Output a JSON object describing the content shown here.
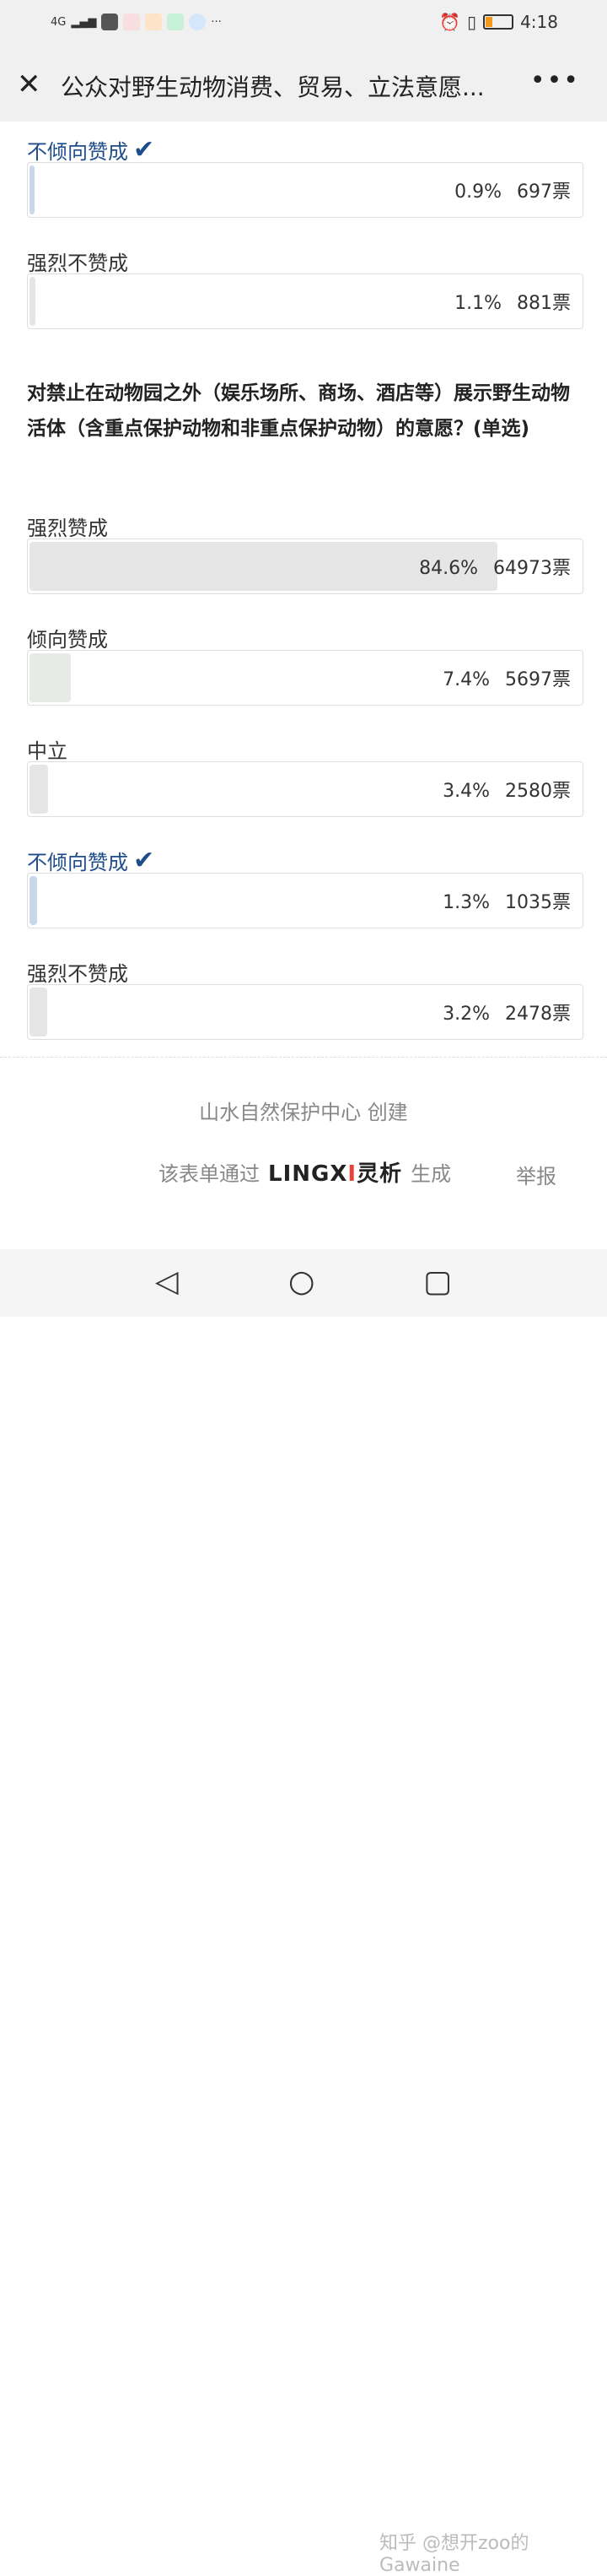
{
  "status_bar": {
    "network": "4G",
    "time": "4:18",
    "battery_color": "#f39a1e"
  },
  "header": {
    "title": "公众对野生动物消费、贸易、立法意愿...",
    "close_icon": "close-icon",
    "more_icon": "more-icon"
  },
  "prev_question": {
    "options": [
      {
        "label": "不倾向赞成",
        "percent": "0.9%",
        "votes": "697票",
        "fraction": 0.009,
        "chosen": true
      },
      {
        "label": "强烈不赞成",
        "percent": "1.1%",
        "votes": "881票",
        "fraction": 0.011,
        "chosen": false
      }
    ]
  },
  "question": {
    "text": "对禁止在动物园之外（娱乐场所、商场、酒店等）展示野生动物活体（含重点保护动物和非重点保护动物）的意愿？(单选)",
    "options": [
      {
        "label": "强烈赞成",
        "percent": "84.6%",
        "votes": "64973票",
        "fraction": 0.846,
        "chosen": false
      },
      {
        "label": "倾向赞成",
        "percent": "7.4%",
        "votes": "5697票",
        "fraction": 0.074,
        "chosen": false
      },
      {
        "label": "中立",
        "percent": "3.4%",
        "votes": "2580票",
        "fraction": 0.034,
        "chosen": false
      },
      {
        "label": "不倾向赞成",
        "percent": "1.3%",
        "votes": "1035票",
        "fraction": 0.013,
        "chosen": true
      },
      {
        "label": "强烈不赞成",
        "percent": "3.2%",
        "votes": "2478票",
        "fraction": 0.032,
        "chosen": false
      }
    ]
  },
  "footer": {
    "creator": "山水自然保护中心 创建",
    "gen_prefix": "该表单通过",
    "logo": "LINGXI灵析",
    "gen_suffix": "生成",
    "report": "举报"
  },
  "watermark": "知乎 @想开zoo的Gawaine",
  "colors": {
    "chosen": "#1f4d8c",
    "fill_default": "#e6e6e6",
    "fill_chosen": "#c9d7eb",
    "fill_green": "#e6ebe6"
  }
}
